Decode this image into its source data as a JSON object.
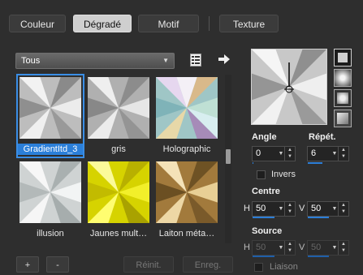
{
  "tabs": [
    {
      "label": "Couleur",
      "active": false
    },
    {
      "label": "Dégradé",
      "active": true
    },
    {
      "label": "Motif",
      "active": false
    },
    {
      "label": "Texture",
      "active": false
    }
  ],
  "category": {
    "selected": "Tous"
  },
  "icons": {
    "library": "library-list-icon",
    "arrow": "arrow-right-icon",
    "dropdown": "chevron-down-icon"
  },
  "gradients": [
    {
      "label": "GradientItd_3",
      "selected": true,
      "style": "metal"
    },
    {
      "label": "gris",
      "selected": false,
      "style": "grey"
    },
    {
      "label": "Holographic",
      "selected": false,
      "style": "holo"
    },
    {
      "label": "illusion",
      "selected": false,
      "style": "illusion"
    },
    {
      "label": "Jaunes mult…",
      "selected": false,
      "style": "yellow"
    },
    {
      "label": "Laiton méta…",
      "selected": false,
      "style": "brass"
    }
  ],
  "buttons": {
    "add": "+",
    "remove": "-",
    "reset": "Réinit.",
    "save": "Enreg."
  },
  "angle": {
    "label": "Angle",
    "value": "0"
  },
  "repeat": {
    "label": "Répét.",
    "value": "6"
  },
  "invert": {
    "label": "Invers",
    "checked": false
  },
  "center": {
    "label": "Centre",
    "h_label": "H",
    "h_value": "50",
    "v_label": "V",
    "v_value": "50"
  },
  "source": {
    "label": "Source",
    "h_label": "H",
    "h_value": "50",
    "v_label": "V",
    "v_value": "50"
  },
  "link": {
    "label": "Liaison",
    "checked": false
  },
  "colors": {
    "accent": "#2b7fd9",
    "panel": "#2e2e2e"
  }
}
